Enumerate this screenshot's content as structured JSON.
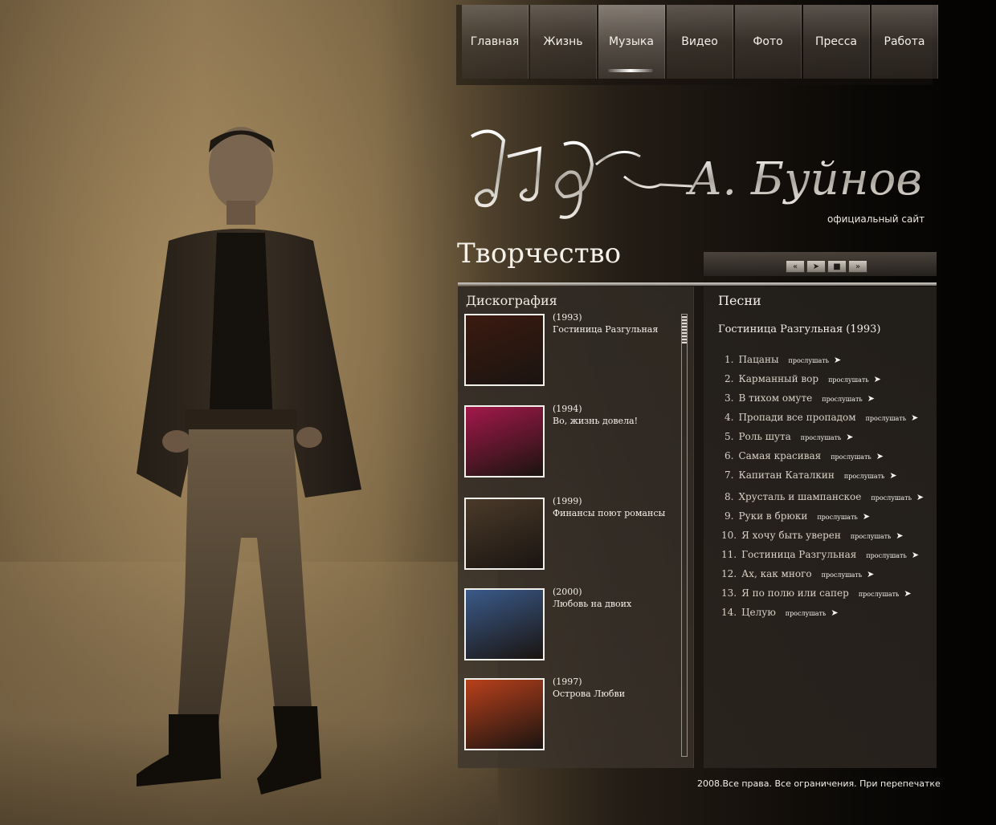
{
  "nav": {
    "items": [
      {
        "label": "Главная"
      },
      {
        "label": "Жизнь"
      },
      {
        "label": "Музыка",
        "active": true
      },
      {
        "label": "Видео"
      },
      {
        "label": "Фото"
      },
      {
        "label": "Пресса"
      },
      {
        "label": "Работа"
      }
    ]
  },
  "logo": {
    "text": "А. Буйнов",
    "subtitle": "официальный сайт"
  },
  "section": {
    "title": "Творчество"
  },
  "player": {
    "controls": [
      "prev-icon",
      "play-icon",
      "stop-icon",
      "next-icon"
    ]
  },
  "discography": {
    "title": "Дискография",
    "albums": [
      {
        "year": "(1993)",
        "name": "Гостиница Разгульная",
        "cover_color": "#3b1a10"
      },
      {
        "year": "(1994)",
        "name": "Во, жизнь довела!",
        "cover_color": "#a3184a"
      },
      {
        "year": "(1999)",
        "name": "Финансы поют романсы",
        "cover_color": "#4a3a2a"
      },
      {
        "year": "(2000)",
        "name": "Любовь на двоих",
        "cover_color": "#3a5a8a"
      },
      {
        "year": "(1997)",
        "name": "Острова Любви",
        "cover_color": "#b8401c"
      }
    ]
  },
  "songs": {
    "title": "Песни",
    "album_heading": "Гостиница Разгульная (1993)",
    "listen_label": "прослушать",
    "items": [
      {
        "num": "1.",
        "title": "Пацаны"
      },
      {
        "num": "2.",
        "title": "Карманный вор"
      },
      {
        "num": "3.",
        "title": "В тихом омуте"
      },
      {
        "num": "4.",
        "title": "Пропади все пропадом"
      },
      {
        "num": "5.",
        "title": "Роль шута"
      },
      {
        "num": "6.",
        "title": "Самая красивая"
      },
      {
        "num": "7.",
        "title": "Капитан Каталкин"
      },
      {
        "num": "8.",
        "title": "Хрусталь и шампанское"
      },
      {
        "num": "9.",
        "title": "Руки в брюки"
      },
      {
        "num": "10.",
        "title": "Я хочу быть уверен"
      },
      {
        "num": "11.",
        "title": "Гостиница Разгульная"
      },
      {
        "num": "12.",
        "title": "Ах, как много"
      },
      {
        "num": "13.",
        "title": "Я по полю или сапер"
      },
      {
        "num": "14.",
        "title": "Целую"
      }
    ]
  },
  "footer": {
    "text": "2008.Все права. Все ограничения. При перепечатке"
  }
}
